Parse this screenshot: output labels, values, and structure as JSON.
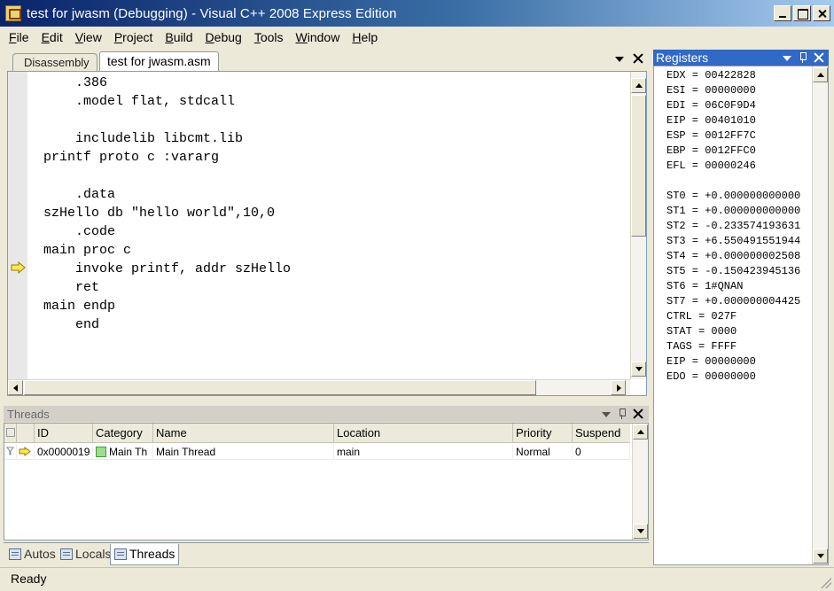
{
  "window": {
    "title": "test for jwasm (Debugging) - Visual C++ 2008 Express Edition"
  },
  "menu": [
    {
      "label": "File",
      "mnemonic": "F",
      "rest": "ile"
    },
    {
      "label": "Edit",
      "mnemonic": "E",
      "rest": "dit"
    },
    {
      "label": "View",
      "mnemonic": "V",
      "rest": "iew"
    },
    {
      "label": "Project",
      "mnemonic": "P",
      "rest": "roject"
    },
    {
      "label": "Build",
      "mnemonic": "B",
      "rest": "uild"
    },
    {
      "label": "Debug",
      "mnemonic": "D",
      "rest": "ebug"
    },
    {
      "label": "Tools",
      "mnemonic": "T",
      "rest": "ools"
    },
    {
      "label": "Window",
      "mnemonic": "W",
      "rest": "indow"
    },
    {
      "label": "Help",
      "mnemonic": "H",
      "rest": "elp"
    }
  ],
  "doc_tabs": {
    "inactive": "Disassembly",
    "active": "test for jwasm.asm"
  },
  "editor": {
    "code": "    .386\n    .model flat, stdcall\n\n    includelib libcmt.lib\nprintf proto c :vararg\n\n    .data\nszHello db \"hello world\",10,0\n    .code\nmain proc c\n    invoke printf, addr szHello\n    ret\nmain endp\n    end",
    "current_line_icon": "yellow-arrow-icon"
  },
  "threads": {
    "title": "Threads",
    "columns": [
      "",
      "ID",
      "Category",
      "Name",
      "Location",
      "Priority",
      "Suspend"
    ],
    "rows": [
      {
        "id": "0x0000019",
        "category": "Main Th",
        "name": "Main Thread",
        "location": "main",
        "priority": "Normal",
        "suspend": "0"
      }
    ]
  },
  "bottom_tabs": [
    {
      "label": "Autos",
      "active": false
    },
    {
      "label": "Locals",
      "active": false
    },
    {
      "label": "Threads",
      "active": true
    }
  ],
  "registers": {
    "title": "Registers",
    "lines": "EDX = 00422828\nESI = 00000000\nEDI = 06C0F9D4\nEIP = 00401010\nESP = 0012FF7C\nEBP = 0012FFC0\nEFL = 00000246\n\nST0 = +0.000000000000\nST1 = +0.000000000000\nST2 = -0.233574193631\nST3 = +6.550491551944\nST4 = +0.000000002508\nST5 = -0.150423945136\nST6 = 1#QNAN\nST7 = +0.000000004425\nCTRL = 027F\nSTAT = 0000\nTAGS = FFFF\nEIP = 00000000\nEDO = 00000000"
  },
  "status": {
    "text": "Ready"
  },
  "colors": {
    "active_panel_header": "#3169c6",
    "inactive_panel_header": "#d4d0c8",
    "category_swatch": "#9be08a"
  }
}
